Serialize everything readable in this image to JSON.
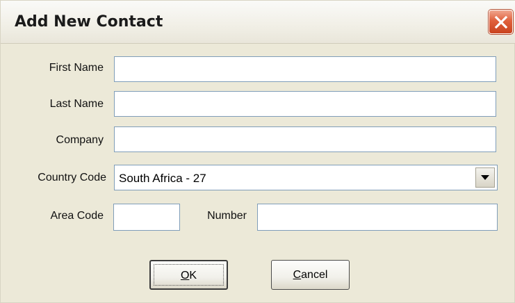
{
  "window": {
    "title": "Add New Contact",
    "close_icon": "close-icon"
  },
  "form": {
    "first_name": {
      "label": "First Name",
      "value": ""
    },
    "last_name": {
      "label": "Last Name",
      "value": ""
    },
    "company": {
      "label": "Company",
      "value": ""
    },
    "country_code": {
      "label": "Country Code",
      "selected": "South Africa - 27"
    },
    "area_code": {
      "label": "Area Code",
      "value": ""
    },
    "number": {
      "label": "Number",
      "value": ""
    }
  },
  "buttons": {
    "ok": {
      "accel": "O",
      "rest": "K"
    },
    "cancel": {
      "accel": "C",
      "rest": "ancel"
    }
  },
  "colors": {
    "dialog_bg": "#ece9d8",
    "field_border": "#7f9db9",
    "close_red": "#e0613c"
  }
}
